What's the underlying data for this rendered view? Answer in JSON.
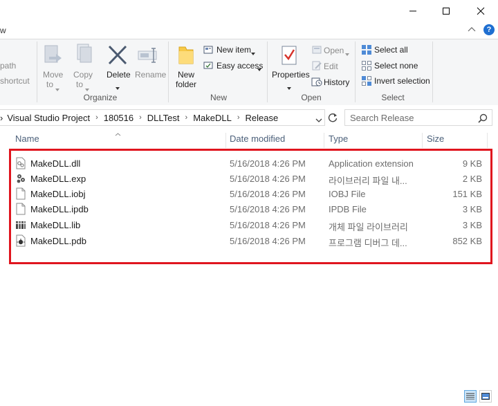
{
  "window": {
    "minimize_icon": "minimize-icon",
    "maximize_icon": "maximize-icon",
    "close_icon": "close-icon"
  },
  "tabs": {
    "view_fragment": "w"
  },
  "help": {
    "label": "?"
  },
  "ribbon": {
    "clipboard_partial": {
      "copy_path": "path",
      "paste_shortcut": "shortcut"
    },
    "organize": {
      "move_to_1": "Move",
      "move_to_2": "to",
      "copy_to_1": "Copy",
      "copy_to_2": "to",
      "delete": "Delete",
      "rename": "Rename",
      "group": "Organize"
    },
    "new": {
      "new_folder_1": "New",
      "new_folder_2": "folder",
      "new_item": "New item",
      "easy_access": "Easy access",
      "group": "New"
    },
    "open": {
      "properties": "Properties",
      "open": "Open",
      "edit": "Edit",
      "history": "History",
      "group": "Open"
    },
    "select": {
      "select_all": "Select all",
      "select_none": "Select none",
      "invert": "Invert selection",
      "group": "Select"
    }
  },
  "address": {
    "breadcrumbs": [
      "Visual Studio Project",
      "180516",
      "DLLTest",
      "MakeDLL",
      "Release"
    ],
    "search_placeholder": "Search Release"
  },
  "columns": {
    "name": "Name",
    "date": "Date modified",
    "type": "Type",
    "size": "Size"
  },
  "files": [
    {
      "name": "MakeDLL.dll",
      "date": "5/16/2018 4:26 PM",
      "type": "Application extension",
      "size": "9 KB",
      "icon": "dll-file-icon"
    },
    {
      "name": "MakeDLL.exp",
      "date": "5/16/2018 4:26 PM",
      "type": "라이브러리 파일 내...",
      "size": "2 KB",
      "icon": "exp-file-icon"
    },
    {
      "name": "MakeDLL.iobj",
      "date": "5/16/2018 4:26 PM",
      "type": "IOBJ File",
      "size": "151 KB",
      "icon": "blank-file-icon"
    },
    {
      "name": "MakeDLL.ipdb",
      "date": "5/16/2018 4:26 PM",
      "type": "IPDB File",
      "size": "3 KB",
      "icon": "blank-file-icon"
    },
    {
      "name": "MakeDLL.lib",
      "date": "5/16/2018 4:26 PM",
      "type": "개체 파일 라이브러리",
      "size": "3 KB",
      "icon": "lib-file-icon"
    },
    {
      "name": "MakeDLL.pdb",
      "date": "5/16/2018 4:26 PM",
      "type": "프로그램 디버그 데...",
      "size": "852 KB",
      "icon": "pdb-file-icon"
    }
  ],
  "colors": {
    "highlight": "#e0151e",
    "header_text": "#4c607a",
    "accent": "#1f6fd1"
  }
}
